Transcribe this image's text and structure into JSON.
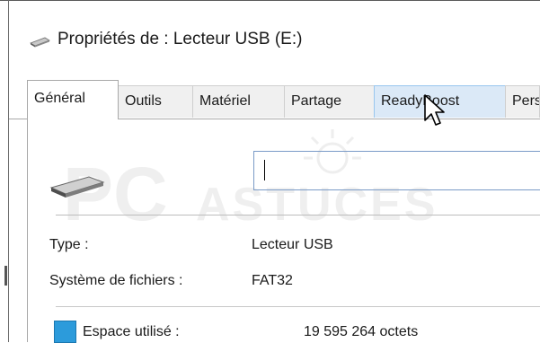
{
  "window": {
    "title": "Propriétés de : Lecteur USB (E:)",
    "icon": "usb-drive-icon"
  },
  "tabs": [
    {
      "label": "Général",
      "state": "active"
    },
    {
      "label": "Outils",
      "state": "normal"
    },
    {
      "label": "Matériel",
      "state": "normal"
    },
    {
      "label": "Partage",
      "state": "normal"
    },
    {
      "label": "ReadyBoost",
      "state": "hover"
    },
    {
      "label": "Pers",
      "state": "normal"
    }
  ],
  "general": {
    "drive_icon": "usb-drive-icon",
    "name_value": "",
    "type_label": "Type :",
    "type_value": "Lecteur USB",
    "fs_label": "Système de fichiers :",
    "fs_value": "FAT32",
    "used_label": "Espace utilisé :",
    "used_value": "19 595 264 octets",
    "used_color": "#2c9bdb"
  },
  "watermark": {
    "big": "PC",
    "small": "ASTUCES"
  },
  "colors": {
    "tab_hover_bg": "#dbe9f7",
    "input_border": "#7a9ac7",
    "used_swatch": "#2c9bdb"
  }
}
